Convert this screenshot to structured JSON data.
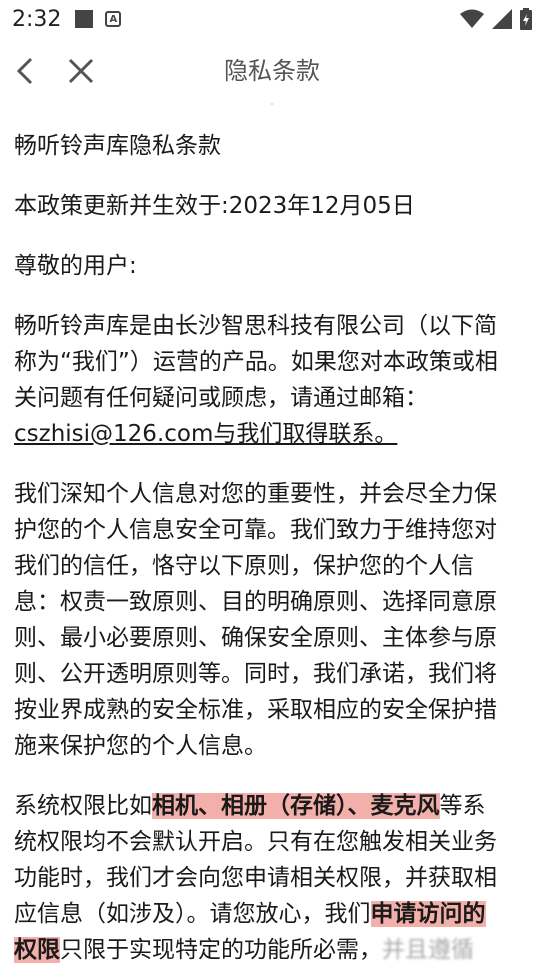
{
  "status_bar": {
    "time": "2:32"
  },
  "nav": {
    "title": "隐私条款"
  },
  "content": {
    "heading": "畅听铃声库隐私条款",
    "effective": "本政策更新并生效于:2023年12月05日",
    "greeting": "尊敬的用户:",
    "intro_lines": [
      "畅听铃声库是由长沙智思科技有限公司（以下简",
      "称为“我们”）运营的产品。如果您对本政策或相",
      "关问题有任何疑问或顾虑，请通过邮箱："
    ],
    "email": "cszhisi@126.com与我们取得联系。",
    "principles_lines": [
      "我们深知个人信息对您的重要性，并会尽全力保",
      "护您的个人信息安全可靠。我们致力于维持您对",
      "我们的信任，恪守以下原则，保护您的个人信",
      "息：权责一致原则、目的明确原则、选择同意原",
      "则、最小必要原则、确保安全原则、主体参与原",
      "则、公开透明原则等。同时，我们承诺，我们将",
      "按业界成熟的安全标准，采取相应的安全保护措",
      "施来保护您的个人信息。"
    ],
    "perm": {
      "line1_pre": "系统权限比如",
      "line1_hl": "相机、相册（存储）、麦克风",
      "line1_post": "等系",
      "line2": "统权限均不会默认开启。只有在您触发相关业务",
      "line3": "功能时，我们才会向您申请相关权限，并获取相",
      "line4_pre": "应信息（如涉及）。请您放心，我们",
      "line4_hl": "申请访问的",
      "line5_hl": "权限",
      "line5_post": "只限于实现特定的功能所必需，",
      "line5_blur": "并且遵循"
    }
  }
}
